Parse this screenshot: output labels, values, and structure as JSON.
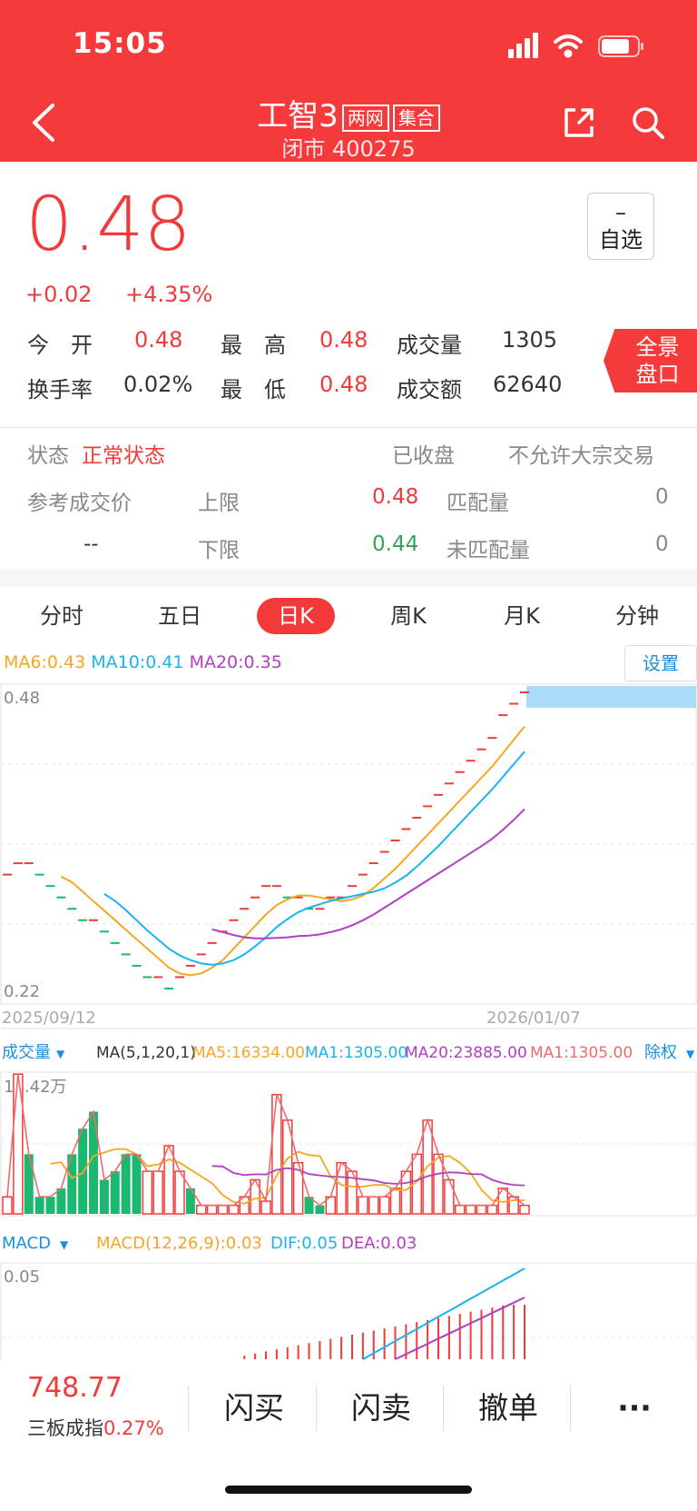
{
  "status_bar": {
    "time": "15:05"
  },
  "header": {
    "name": "工智3",
    "tag1": "两网",
    "tag2": "集合",
    "status": "闭市",
    "code": "400275"
  },
  "quote": {
    "price": "0.48",
    "change": "+0.02",
    "change_pct": "+4.35%",
    "watch_symbol": "–",
    "watch_label": "自选",
    "stats": {
      "open_label": "今　开",
      "open": "0.48",
      "high_label": "最　高",
      "high": "0.48",
      "vol_label": "成交量",
      "vol": "1305",
      "turnover_label": "换手率",
      "turnover": "0.02%",
      "low_label": "最　低",
      "low": "0.48",
      "amount_label": "成交额",
      "amount": "62640"
    },
    "panorama_label": "全景\n盘口"
  },
  "state": {
    "state_label": "状态",
    "state_value": "正常状态",
    "closed": "已收盘",
    "block_trade": "不允许大宗交易",
    "ref_price_label": "参考成交价",
    "ref_price": "--",
    "upper_label": "上限",
    "upper": "0.48",
    "lower_label": "下限",
    "lower": "0.44",
    "matched_label": "匹配量",
    "matched": "0",
    "unmatched_label": "未匹配量",
    "unmatched": "0"
  },
  "tabs": [
    "分时",
    "五日",
    "日K",
    "周K",
    "月K",
    "分钟"
  ],
  "active_tab": "日K",
  "ma_legend": {
    "ma6": "MA6:0.43",
    "ma10": "MA10:0.41",
    "ma20": "MA20:0.35",
    "setting": "设置"
  },
  "colors": {
    "up": "#f23a3a",
    "down": "#1db870",
    "ma6": "#f5a623",
    "ma10": "#1ab3ee",
    "ma20": "#b13fc2",
    "vol_ma1": "#f06a6a"
  },
  "kline": {
    "y_top_label": "0.48",
    "y_bottom_label": "0.22",
    "x_start_label": "2025/09/12",
    "x_end_label": "2026/01/07"
  },
  "volume": {
    "title": "成交量",
    "params": "MA(5,1,20,1)",
    "ma5": "MA5:16334.00",
    "ma1": "MA1:1305.00",
    "ma20": "MA20:23885.00",
    "ma1b": "MA1:1305.00",
    "exright": "除权",
    "top_label": "16.42万"
  },
  "macd": {
    "title": "MACD",
    "params": "MACD(12,26,9):0.03",
    "dif": "DIF:0.05",
    "dea": "DEA:0.03",
    "top_label": "0.05"
  },
  "bottom": {
    "index_value": "748.77",
    "index_name": "三板成指",
    "index_pct": "0.27%",
    "buy": "闪买",
    "sell": "闪卖",
    "cancel": "撤单",
    "more": "···"
  },
  "chart_data": {
    "type": "candlestick",
    "x_start": "2025/09/12",
    "x_end": "2026/01/07",
    "ylim": [
      0.22,
      0.48
    ],
    "close": [
      0.32,
      0.33,
      0.33,
      0.32,
      0.31,
      0.3,
      0.29,
      0.28,
      0.28,
      0.27,
      0.26,
      0.25,
      0.24,
      0.23,
      0.23,
      0.22,
      0.23,
      0.24,
      0.25,
      0.26,
      0.27,
      0.28,
      0.29,
      0.3,
      0.31,
      0.31,
      0.3,
      0.3,
      0.29,
      0.29,
      0.3,
      0.3,
      0.31,
      0.32,
      0.33,
      0.34,
      0.35,
      0.36,
      0.37,
      0.38,
      0.39,
      0.4,
      0.41,
      0.42,
      0.43,
      0.44,
      0.46,
      0.47,
      0.48
    ],
    "volume": [
      2,
      16.4,
      7,
      2,
      2,
      3,
      7,
      10,
      12,
      4,
      5,
      7,
      7,
      5,
      5,
      8,
      5,
      3,
      1,
      1,
      1,
      1,
      2,
      4,
      1.5,
      14,
      11,
      6,
      2,
      1,
      2,
      6,
      5,
      2,
      2,
      2,
      3,
      5,
      7,
      11,
      7,
      4,
      1,
      1,
      1,
      1,
      3,
      2,
      1
    ],
    "volume_up": [
      true,
      true,
      false,
      false,
      false,
      false,
      false,
      false,
      false,
      false,
      false,
      false,
      false,
      true,
      true,
      true,
      true,
      false,
      true,
      true,
      true,
      true,
      true,
      true,
      true,
      true,
      true,
      true,
      false,
      false,
      true,
      true,
      true,
      true,
      true,
      true,
      true,
      true,
      true,
      true,
      true,
      true,
      true,
      true,
      true,
      true,
      true,
      true,
      true
    ],
    "macd_dif_end": 0.05,
    "macd_dea_end": 0.03
  }
}
